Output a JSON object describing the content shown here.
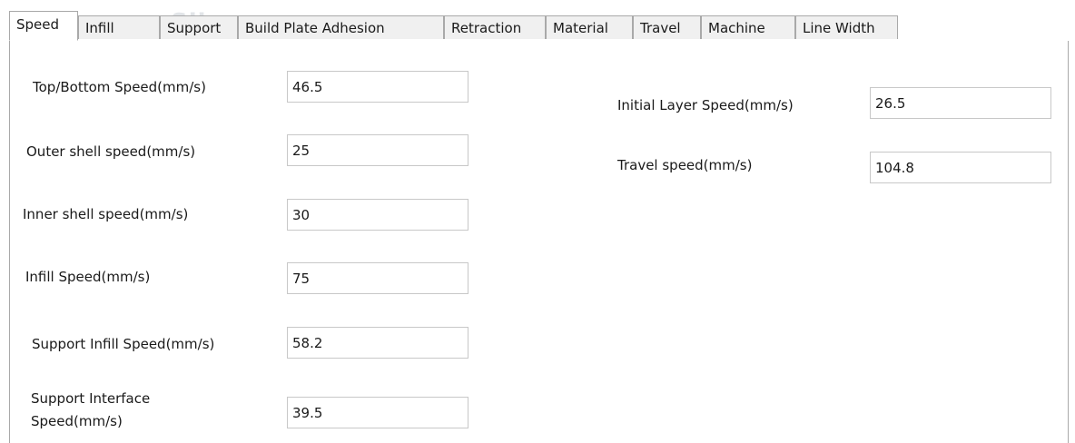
{
  "tabs": [
    {
      "label": "Speed",
      "active": true
    },
    {
      "label": "Infill",
      "active": false
    },
    {
      "label": "Support",
      "active": false
    },
    {
      "label": "Build Plate Adhesion",
      "active": false
    },
    {
      "label": "Retraction",
      "active": false
    },
    {
      "label": "Material",
      "active": false
    },
    {
      "label": "Travel",
      "active": false
    },
    {
      "label": "Machine",
      "active": false
    },
    {
      "label": "Line Width",
      "active": false
    }
  ],
  "background_watermark": "Slice",
  "speed": {
    "top_bottom": {
      "label": "Top/Bottom Speed(mm/s)",
      "value": "46.5"
    },
    "outer_shell": {
      "label": "Outer shell speed(mm/s)",
      "value": "25"
    },
    "inner_shell": {
      "label": "Inner shell speed(mm/s)",
      "value": "30"
    },
    "infill": {
      "label": "Infill Speed(mm/s)",
      "value": "75"
    },
    "support_infill": {
      "label": "Support Infill Speed(mm/s)",
      "value": "58.2"
    },
    "support_interface": {
      "label_line1": "Support Interface",
      "label_line2": "Speed(mm/s)",
      "value": "39.5"
    },
    "initial_layer": {
      "label": "Initial Layer Speed(mm/s)",
      "value": "26.5"
    },
    "travel": {
      "label": "Travel speed(mm/s)",
      "value": "104.8"
    }
  }
}
